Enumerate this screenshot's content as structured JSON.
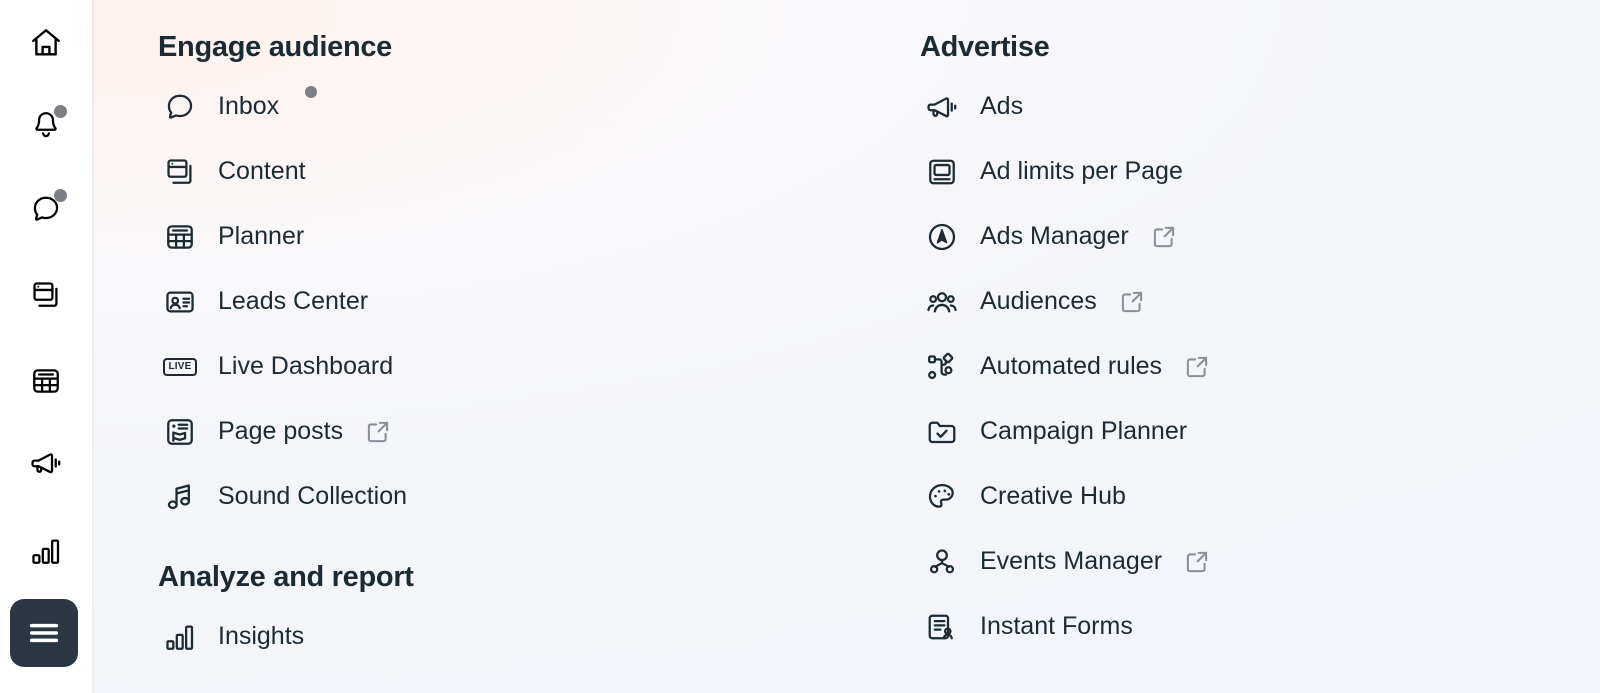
{
  "theme": {
    "text_dark": "#1c2b33",
    "icon_muted": "#8a9099",
    "badge_dot": "#7c7f85",
    "active_pill": "#2b3843",
    "rail_bg": "#ffffff",
    "panel_bg_left": "#fdf9f8",
    "panel_bg_right": "#f2f5f9"
  },
  "rail": {
    "items": [
      {
        "name": "home-icon",
        "icon": "home",
        "badge": false,
        "active": false
      },
      {
        "name": "notifications-icon",
        "icon": "bell",
        "badge": true,
        "active": false
      },
      {
        "name": "messages-icon",
        "icon": "chat-bubble",
        "badge": true,
        "active": false
      },
      {
        "name": "content-icon",
        "icon": "content-cards",
        "badge": false,
        "active": false
      },
      {
        "name": "planner-icon",
        "icon": "calendar-grid",
        "badge": false,
        "active": false
      },
      {
        "name": "ads-icon",
        "icon": "megaphone",
        "badge": false,
        "active": false
      },
      {
        "name": "insights-icon",
        "icon": "bar-chart",
        "badge": false,
        "active": false
      },
      {
        "name": "menu-toggle",
        "icon": "hamburger",
        "badge": false,
        "active": true
      }
    ]
  },
  "columns": {
    "left": {
      "sections": [
        {
          "title": "Engage audience",
          "items": [
            {
              "label": "Inbox",
              "icon": "chat-bubble",
              "external": false,
              "dot": true
            },
            {
              "label": "Content",
              "icon": "content-cards",
              "external": false,
              "dot": false
            },
            {
              "label": "Planner",
              "icon": "calendar-grid",
              "external": false,
              "dot": false
            },
            {
              "label": "Leads Center",
              "icon": "id-card",
              "external": false,
              "dot": false
            },
            {
              "label": "Live Dashboard",
              "icon": "live-badge",
              "external": false,
              "dot": false,
              "badge_text": "LIVE"
            },
            {
              "label": "Page posts",
              "icon": "page-post",
              "external": true,
              "dot": false
            },
            {
              "label": "Sound Collection",
              "icon": "music-note",
              "external": false,
              "dot": false
            }
          ]
        },
        {
          "title": "Analyze and report",
          "items": [
            {
              "label": "Insights",
              "icon": "bar-chart",
              "external": false,
              "dot": false
            }
          ]
        }
      ]
    },
    "right": {
      "sections": [
        {
          "title": "Advertise",
          "items": [
            {
              "label": "Ads",
              "icon": "megaphone",
              "external": false,
              "dot": false
            },
            {
              "label": "Ad limits per Page",
              "icon": "monitor",
              "external": false,
              "dot": false
            },
            {
              "label": "Ads Manager",
              "icon": "compass",
              "external": true,
              "dot": false
            },
            {
              "label": "Audiences",
              "icon": "people-group",
              "external": true,
              "dot": false
            },
            {
              "label": "Automated rules",
              "icon": "flow-nodes",
              "external": true,
              "dot": false
            },
            {
              "label": "Campaign Planner",
              "icon": "folder-check",
              "external": false,
              "dot": false
            },
            {
              "label": "Creative Hub",
              "icon": "palette",
              "external": false,
              "dot": false
            },
            {
              "label": "Events Manager",
              "icon": "events-nodes",
              "external": true,
              "dot": false
            },
            {
              "label": "Instant Forms",
              "icon": "form-person",
              "external": false,
              "dot": false
            }
          ]
        }
      ]
    }
  }
}
